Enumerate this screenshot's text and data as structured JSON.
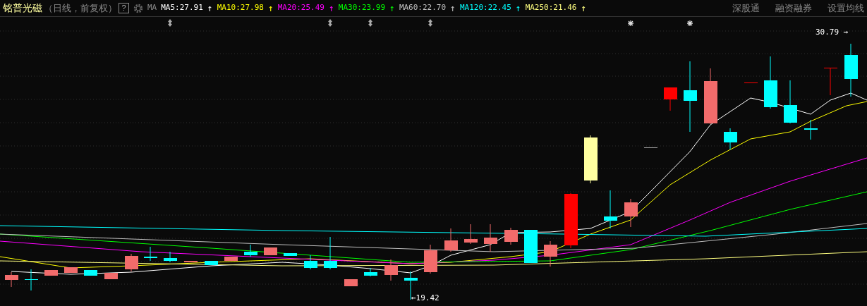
{
  "header": {
    "title": "铭普光磁",
    "subtitle": "（日线，前复权）",
    "help": "?",
    "ma_label": "MA",
    "moving_averages": [
      {
        "label": "MA5:27.91",
        "trend": "↑",
        "color": "#ffffff"
      },
      {
        "label": "MA10:27.98",
        "trend": "↑",
        "color": "#ffff00"
      },
      {
        "label": "MA20:25.49",
        "trend": "↑",
        "color": "#ff00ff"
      },
      {
        "label": "MA30:23.99",
        "trend": "↑",
        "color": "#00ff00"
      },
      {
        "label": "MA60:22.70",
        "trend": "↑",
        "color": "#c0c0c0"
      },
      {
        "label": "MA120:22.45",
        "trend": "↑",
        "color": "#00ffff"
      },
      {
        "label": "MA250:21.46",
        "trend": "↑",
        "color": "#ffff80"
      }
    ],
    "menu": [
      "深股通",
      "融资融券",
      "设置均线"
    ]
  },
  "chart": {
    "high_label": "30.79",
    "high_arrow": "→",
    "low_label": "19.42",
    "low_arrow": "←"
  }
}
